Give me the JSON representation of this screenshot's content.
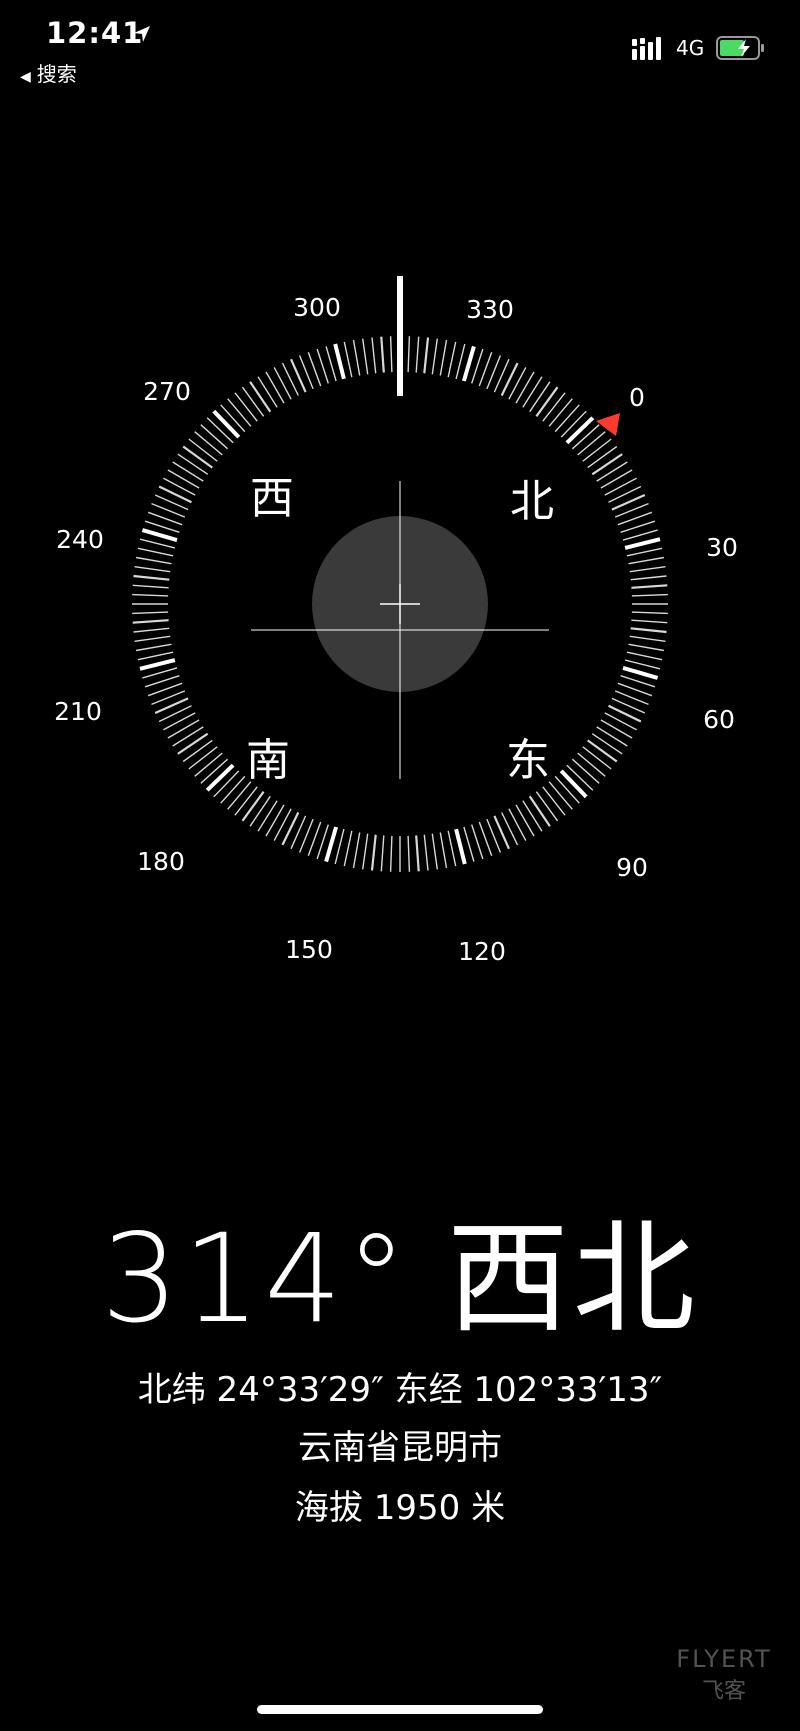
{
  "status_bar": {
    "time": "12:41",
    "back_label": "搜索",
    "network": "4G",
    "icons": [
      "location-arrow-icon",
      "signal-icon",
      "battery-charging-icon"
    ],
    "battery_color": "#4cd964"
  },
  "compass": {
    "heading_marker_color": "#ff3b30",
    "degree_labels": [
      "300",
      "330",
      "0",
      "30",
      "60",
      "90",
      "120",
      "150",
      "180",
      "210",
      "240",
      "270"
    ],
    "cardinals": {
      "north": "北",
      "east": "东",
      "south": "南",
      "west": "西"
    }
  },
  "reading": {
    "heading": "314°",
    "direction": "西北",
    "coordinates": "北纬 24°33′29″  东经 102°33′13″",
    "city": "云南省昆明市",
    "elevation": "海拔 1950 米"
  },
  "watermark": {
    "brand": "FLYERT",
    "brand_cn": "飞客"
  }
}
